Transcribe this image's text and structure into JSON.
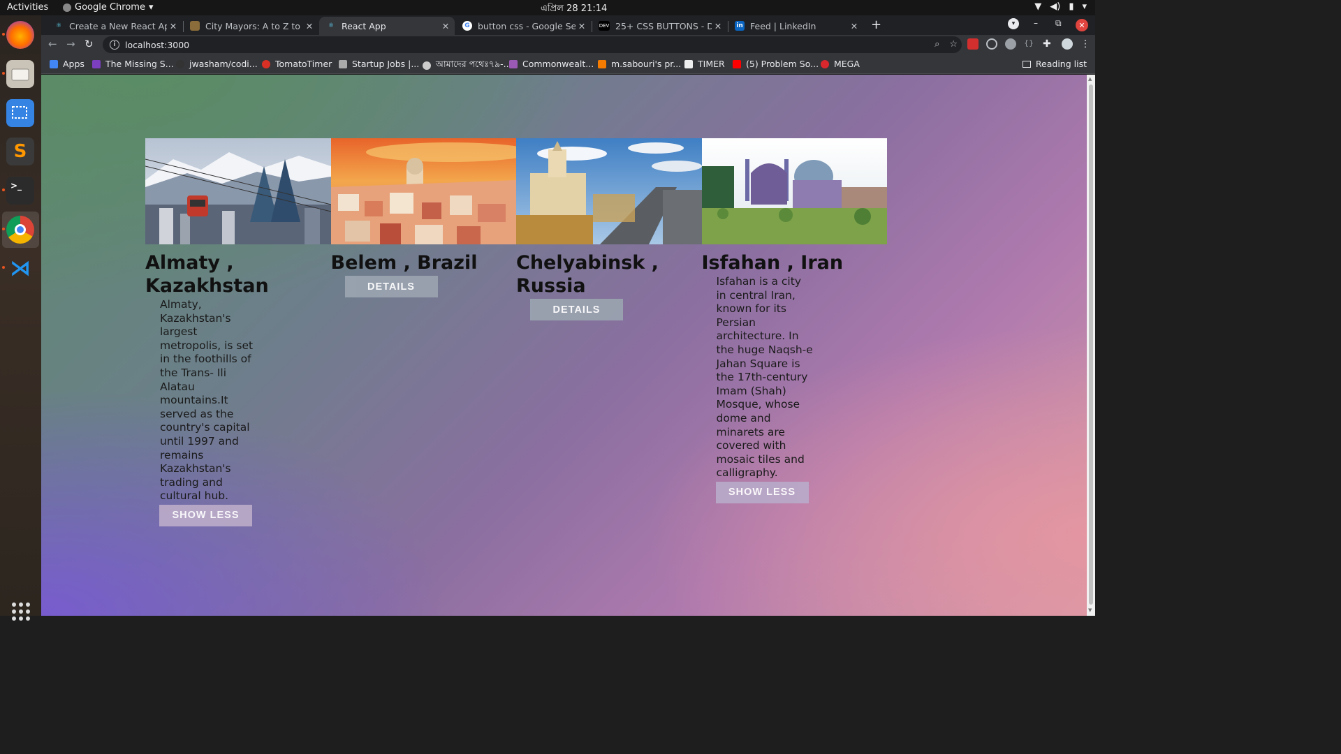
{
  "os": {
    "activities": "Activities",
    "app_name": "Google Chrome",
    "clock": "এপ্রিল 28  21:14"
  },
  "browser": {
    "tabs": [
      {
        "title": "Create a New React App –",
        "favicon": "react-icon",
        "active": false
      },
      {
        "title": "City Mayors: A to Z to larg",
        "favicon": "citymayors-icon",
        "active": false
      },
      {
        "title": "React App",
        "favicon": "react-icon",
        "active": true
      },
      {
        "title": "button css - Google Search",
        "favicon": "google-icon",
        "active": false
      },
      {
        "title": "25+ CSS BUTTONS - DEV C",
        "favicon": "dev-icon",
        "active": false
      },
      {
        "title": "Feed | LinkedIn",
        "favicon": "linkedin-icon",
        "active": false
      }
    ],
    "address": "localhost:3000",
    "bookmarks": [
      {
        "label": "Apps",
        "color": "#4285f4"
      },
      {
        "label": "The Missing S...",
        "color": "#7b3fbf"
      },
      {
        "label": "jwasham/codi...",
        "color": "#333333"
      },
      {
        "label": "TomatoTimer",
        "color": "#d93025"
      },
      {
        "label": "Startup Jobs |...",
        "color": "#aaaaaa"
      },
      {
        "label": "আমাদের পথেঃ৭৯-...",
        "color": "#cccccc"
      },
      {
        "label": "Commonwealt...",
        "color": "#9b59b6"
      },
      {
        "label": "m.sabouri's pr...",
        "color": "#f57c00"
      },
      {
        "label": "TIMER",
        "color": "#eeeeee"
      },
      {
        "label": "(5) Problem So...",
        "color": "#ff0000"
      },
      {
        "label": "MEGA",
        "color": "#d9272e"
      }
    ],
    "reading_list": "Reading list"
  },
  "cities": [
    {
      "name": "Almaty , Kazakhstan",
      "expanded": true,
      "description": "Almaty, Kazakhstan's largest metropolis, is set in the foothills of the Trans- Ili Alatau mountains.It served as the country's capital until 1997 and remains Kazakhstan's trading and cultural hub.",
      "button": "SHOW LESS"
    },
    {
      "name": "Belem , Brazil",
      "expanded": false,
      "description": "",
      "button": "DETAILS"
    },
    {
      "name": "Chelyabinsk , Russia",
      "expanded": false,
      "description": "",
      "button": "DETAILS"
    },
    {
      "name": "Isfahan , Iran",
      "expanded": true,
      "description": "Isfahan is a city in central Iran, known for its Persian architecture. In the huge Naqsh-e Jahan Square is the 17th-century Imam (Shah) Mosque, whose dome and minarets are covered with mosaic tiles and calligraphy.",
      "button": "SHOW LESS"
    }
  ]
}
